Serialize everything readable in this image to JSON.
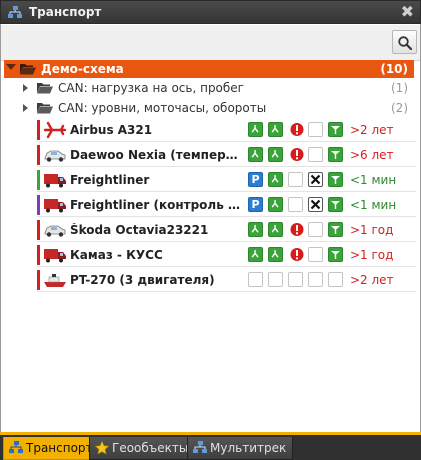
{
  "window": {
    "title": "Транспорт",
    "close_glyph": "✖"
  },
  "toolbar": {
    "search_icon": "magnifier-icon"
  },
  "tree": {
    "root": {
      "label": "Демо-схема",
      "count": "(10)"
    },
    "groups": [
      {
        "label": "CAN: нагрузка на ось, пробег",
        "count": "(1)"
      },
      {
        "label": "CAN: уровни, моточасы, обороты",
        "count": "(2)"
      }
    ],
    "objects": [
      {
        "name": "Airbus A321",
        "vehicle_icon": "airplane-icon",
        "status_color": "#d42020",
        "age": ">2 лет",
        "age_color": "#d42020",
        "icons": [
          "green",
          "green",
          "alert",
          "empty",
          "signal"
        ]
      },
      {
        "name": "Daewoo Nexia (температура...",
        "vehicle_icon": "car-icon",
        "status_color": "#d42020",
        "age": ">6 лет",
        "age_color": "#d42020",
        "icons": [
          "green",
          "green",
          "alert",
          "empty",
          "signal"
        ]
      },
      {
        "name": "Freightliner",
        "vehicle_icon": "truck-icon",
        "status_color": "#3aa33a",
        "age": "<1 мин",
        "age_color": "#2d8a2d",
        "icons": [
          "parking",
          "green",
          "empty",
          "cross",
          "signal"
        ]
      },
      {
        "name": "Freightliner (контроль пере...",
        "vehicle_icon": "truck-icon",
        "status_color": "#7a3fb5",
        "age": "<1 мин",
        "age_color": "#2d8a2d",
        "icons": [
          "parking",
          "green",
          "empty",
          "cross",
          "signal"
        ]
      },
      {
        "name": "Škoda Octavia23221",
        "vehicle_icon": "car-icon",
        "status_color": "#d42020",
        "age": ">1 год",
        "age_color": "#d42020",
        "icons": [
          "green",
          "green",
          "alert",
          "empty",
          "signal"
        ]
      },
      {
        "name": "Камаз - КУСС",
        "vehicle_icon": "truck-icon",
        "status_color": "#d42020",
        "age": ">1 год",
        "age_color": "#d42020",
        "icons": [
          "green",
          "green",
          "alert",
          "empty",
          "signal"
        ]
      },
      {
        "name": "PT-270 (3 двигателя)",
        "vehicle_icon": "ship-icon",
        "status_color": "#d42020",
        "age": ">2 лет",
        "age_color": "#d42020",
        "icons": [
          "empty",
          "empty",
          "empty",
          "empty",
          "empty"
        ]
      }
    ]
  },
  "tabs": [
    {
      "label": "Транспорт",
      "active": true,
      "icon": "network-icon"
    },
    {
      "label": "Геообъекты",
      "active": false,
      "icon": "star-icon"
    },
    {
      "label": "Мультитрек",
      "active": false,
      "icon": "network-icon"
    }
  ],
  "colors": {
    "accent": "#e8560f",
    "tab_active": "#f2b000"
  }
}
